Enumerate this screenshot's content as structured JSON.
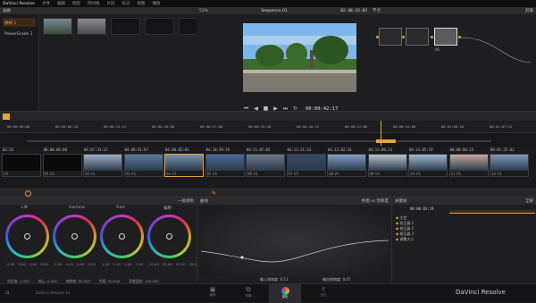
{
  "app": {
    "title": "DaVinci Resolve",
    "brand": "DaVinci Resolve"
  },
  "menu": [
    "文件",
    "编辑",
    "修剪",
    "时间线",
    "片段",
    "标记",
    "视图",
    "播放",
    "帮助",
    "工作区",
    "调色",
    "节点"
  ],
  "gallery": {
    "title": "画廊",
    "still_label": "静帧 1",
    "album": "PowerGrade 1"
  },
  "viewer": {
    "zoom": "53%",
    "sequence": "Sequence 01",
    "timecode": "02:48:33:03",
    "play_tc": "00:00:42:17"
  },
  "nodes": {
    "title": "节点",
    "panel_label": "剪辑",
    "node_label": "05"
  },
  "timeline": {
    "ruler": [
      "00:00:00:00",
      "00:00:06:18",
      "00:00:13:12",
      "00:00:20:06",
      "00:00:27:00",
      "00:00:33:18",
      "00:00:40:12",
      "00:00:47:06",
      "00:00:54:00",
      "00:01:00:18",
      "00:01:07:12"
    ]
  },
  "clips": [
    {
      "tc": "02:24",
      "label": "V1"
    },
    {
      "tc": "00:00:00:00",
      "label": "01  V1"
    },
    {
      "tc": "04:07:33:12",
      "label": "02  V1"
    },
    {
      "tc": "04:08:41:07",
      "label": "03  V1"
    },
    {
      "tc": "04:08:02:03",
      "label": "04  V1"
    },
    {
      "tc": "04:10:59:19",
      "label": "05  V1"
    },
    {
      "tc": "04:11:07:03",
      "label": "06  V1"
    },
    {
      "tc": "04:11:21:14",
      "label": "07  V1"
    },
    {
      "tc": "04:13:02:14",
      "label": "08  V1"
    },
    {
      "tc": "04:13:08:24",
      "label": "09  V1"
    },
    {
      "tc": "04:14:05:19",
      "label": "10  V1"
    },
    {
      "tc": "00:00:00:15",
      "label": "11  V1"
    },
    {
      "tc": "00:01:25:02",
      "label": "12  V1"
    }
  ],
  "color": {
    "title": "一级调色",
    "wheels": [
      {
        "name": "Lift",
        "values": [
          "0.00",
          "0.00",
          "0.00",
          "0.00"
        ]
      },
      {
        "name": "Gamma",
        "values": [
          "0.00",
          "0.00",
          "0.00",
          "0.00"
        ]
      },
      {
        "name": "Gain",
        "values": [
          "1.00",
          "1.00",
          "1.00",
          "1.00"
        ]
      },
      {
        "name": "偏移",
        "values": [
          "25.00",
          "25.00",
          "25.00",
          "25.00"
        ]
      }
    ],
    "bottom_params": [
      "对比度: 1.000",
      "轴心: 0.500",
      "饱和度: 50.000",
      "色相: 50.000",
      "亮度混合: 100.000"
    ]
  },
  "curves": {
    "title": "曲线",
    "mode": "色相 vs 饱和度",
    "input_label": "输入饱和度: 0.11",
    "output_label": "输出饱和度: 0.47"
  },
  "keyframes": {
    "title": "关键帧",
    "all": "全部",
    "tc": "00:00:03:19",
    "rows": [
      "主控",
      "校正器 1",
      "校正器 2",
      "校正器 3",
      "调整大小"
    ]
  },
  "pages": [
    "媒体",
    "剪辑",
    "调色",
    "交付"
  ],
  "bottom": {
    "left_label": "DaVinci Resolve 14"
  },
  "colors": {
    "accent": "#e8a33a",
    "bg": "#1c1c1e"
  }
}
